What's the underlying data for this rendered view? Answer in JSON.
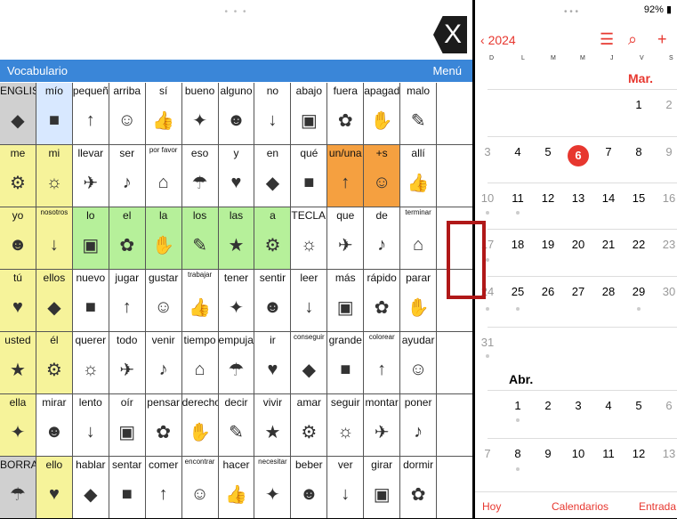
{
  "aac": {
    "toolbar_label": "Vocabulario",
    "menu_label": "Menú",
    "close_label": "X",
    "cells": [
      [
        "ENGLISH",
        "mío",
        "pequeño",
        "arriba",
        "sí",
        "bueno",
        "alguno",
        "no",
        "abajo",
        "fuera",
        "apagado",
        "malo",
        ""
      ],
      [
        "me",
        "mi",
        "llevar",
        "ser",
        "por favor",
        "eso",
        "y",
        "en",
        "qué",
        "un/una",
        "+s",
        "allí",
        ""
      ],
      [
        "yo",
        "nosotros",
        "lo",
        "el",
        "la",
        "los",
        "las",
        "a",
        "TECLADO",
        "que",
        "de",
        "terminar",
        ""
      ],
      [
        "tú",
        "ellos",
        "nuevo",
        "jugar",
        "gustar",
        "trabajar",
        "tener",
        "sentir",
        "leer",
        "más",
        "rápido",
        "parar",
        ""
      ],
      [
        "usted",
        "él",
        "querer",
        "todo",
        "venir",
        "tiempo",
        "empujar",
        "ir",
        "conseguir",
        "grande",
        "colorear",
        "ayudar",
        ""
      ],
      [
        "ella",
        "mirar",
        "lento",
        "oír",
        "pensar",
        "derecho",
        "decir",
        "vivir",
        "amar",
        "seguir",
        "montar",
        "poner",
        ""
      ],
      [
        "BORRAR",
        "ello",
        "hablar",
        "sentar",
        "comer",
        "encontrar",
        "hacer",
        "necesitar",
        "beber",
        "ver",
        "girar",
        "dormir",
        ""
      ]
    ]
  },
  "calendar": {
    "back_label": "2024",
    "weekdays": [
      "D",
      "L",
      "M",
      "M",
      "J",
      "V",
      "S"
    ],
    "month1": "Mar.",
    "month2": "Abr.",
    "tab_today": "Hoy",
    "tab_calendars": "Calendarios",
    "tab_inbox": "Entrada",
    "battery": "92%"
  }
}
